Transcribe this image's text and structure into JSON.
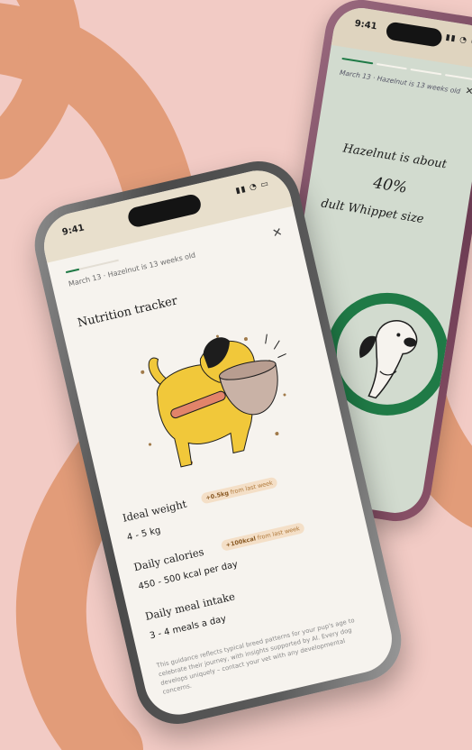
{
  "colors": {
    "background": "#f2cbc5",
    "ribbon": "#e29c79",
    "accent_green": "#1f7a46",
    "badge_bg": "#f4dfc7",
    "dog_yellow": "#f1c83a"
  },
  "back_phone": {
    "status_time": "9:41",
    "status_icons": "signal-wifi-battery",
    "subtitle": "March 13 · Hazelnut is 13 weeks old",
    "close_icon": "close-icon",
    "headline_line1": "Hazelnut is about",
    "headline_percent": "40%",
    "headline_line3": "dult Whippet size"
  },
  "front_phone": {
    "status_time": "9:41",
    "status_icons": "signal-wifi-battery",
    "subtitle": "March 13 · Hazelnut is 13 weeks old",
    "close_icon": "close-icon",
    "title": "Nutrition tracker",
    "metrics": [
      {
        "label": "Ideal weight",
        "value": "4 - 5 kg",
        "badge_value": "+0.5kg",
        "badge_suffix": " from last week"
      },
      {
        "label": "Daily calories",
        "value": "450 - 500 kcal per day",
        "badge_value": "+100kcal",
        "badge_suffix": " from last week"
      },
      {
        "label": "Daily meal intake",
        "value": "3 - 4 meals a day"
      }
    ],
    "disclaimer": "This guidance reflects typical breed patterns for your pup's age to celebrate their journey, with insights supported by AI. Every dog develops uniquely – contact your vet with any developmental concerns."
  }
}
